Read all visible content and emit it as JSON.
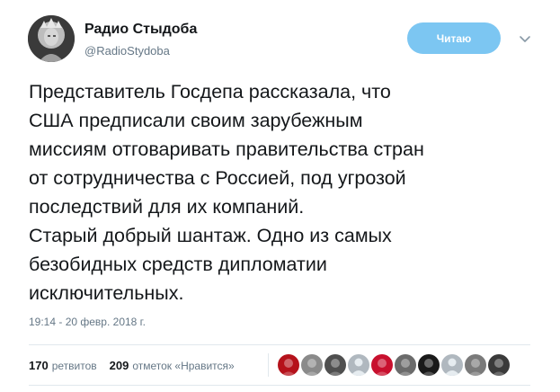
{
  "author": {
    "name": "Радио Стыдоба",
    "handle": "@RadioStydoba"
  },
  "follow_button": {
    "label": "Читаю",
    "color": "#7cc6f2"
  },
  "menu_icon": "chevron-down-icon",
  "tweet": {
    "lines": [
      "Представитель Госдепа рассказала, что",
      "США предписали своим зарубежным",
      "миссиям отговаривать правительства стран",
      "от сотрудничества с Россией, под угрозой",
      "последствий для их компаний.",
      "Старый добрый шантаж. Одно из самых",
      "безобидных средств дипломатии",
      "исключительных."
    ]
  },
  "timestamp": "19:14 - 20 февр. 2018 г.",
  "stats": {
    "retweets_count": "170",
    "retweets_label": "ретвитов",
    "likes_count": "209",
    "likes_label": "отметок «Нравится»"
  },
  "likers": [
    {
      "icon": "avatar-icon",
      "color": "#b5121b"
    },
    {
      "icon": "avatar-icon",
      "color": "#8a8a8a"
    },
    {
      "icon": "avatar-icon",
      "color": "#4f4f4f"
    },
    {
      "icon": "default-avatar-icon",
      "color": "#b0b8bf"
    },
    {
      "icon": "avatar-icon",
      "color": "#c8102e"
    },
    {
      "icon": "avatar-icon",
      "color": "#6b6b6b"
    },
    {
      "icon": "avatar-icon",
      "color": "#1a1a1a"
    },
    {
      "icon": "default-avatar-icon",
      "color": "#b0b8bf"
    },
    {
      "icon": "avatar-icon",
      "color": "#7a7a7a"
    },
    {
      "icon": "avatar-icon",
      "color": "#3a3a3a"
    }
  ],
  "colors": {
    "text": "#14171a",
    "secondary": "#657786",
    "divider": "#e1e8ed"
  }
}
